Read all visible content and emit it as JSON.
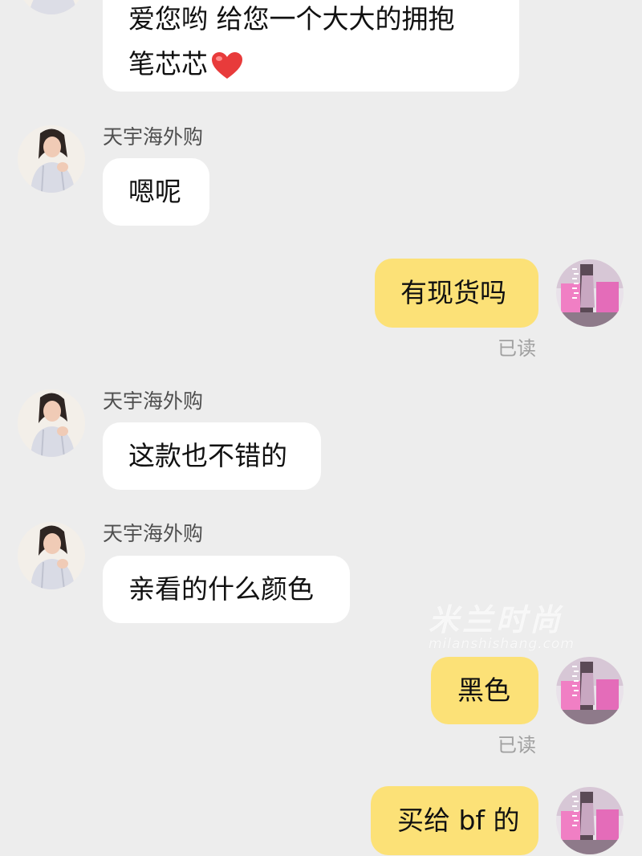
{
  "colors": {
    "background": "#ededed",
    "incoming_bubble": "#ffffff",
    "outgoing_bubble": "#fce177",
    "read_status": "#a0a0a0"
  },
  "messages": [
    {
      "direction": "incoming",
      "sender": "",
      "line1": "爱您哟 给您一个大大的拥抱",
      "line2": "笔芯芯",
      "emoji": "red-heart-icon"
    },
    {
      "direction": "incoming",
      "sender": "天宇海外购",
      "text": "嗯呢"
    },
    {
      "direction": "outgoing",
      "text": "有现货吗",
      "status": "已读"
    },
    {
      "direction": "incoming",
      "sender": "天宇海外购",
      "text": "这款也不错的"
    },
    {
      "direction": "incoming",
      "sender": "天宇海外购",
      "text": "亲看的什么颜色"
    },
    {
      "direction": "outgoing",
      "text": "黑色",
      "status": "已读"
    },
    {
      "direction": "outgoing",
      "text": "买给 bf 的"
    }
  ],
  "watermark": {
    "logo": "米兰时尚",
    "url": "milanshishang.com"
  }
}
